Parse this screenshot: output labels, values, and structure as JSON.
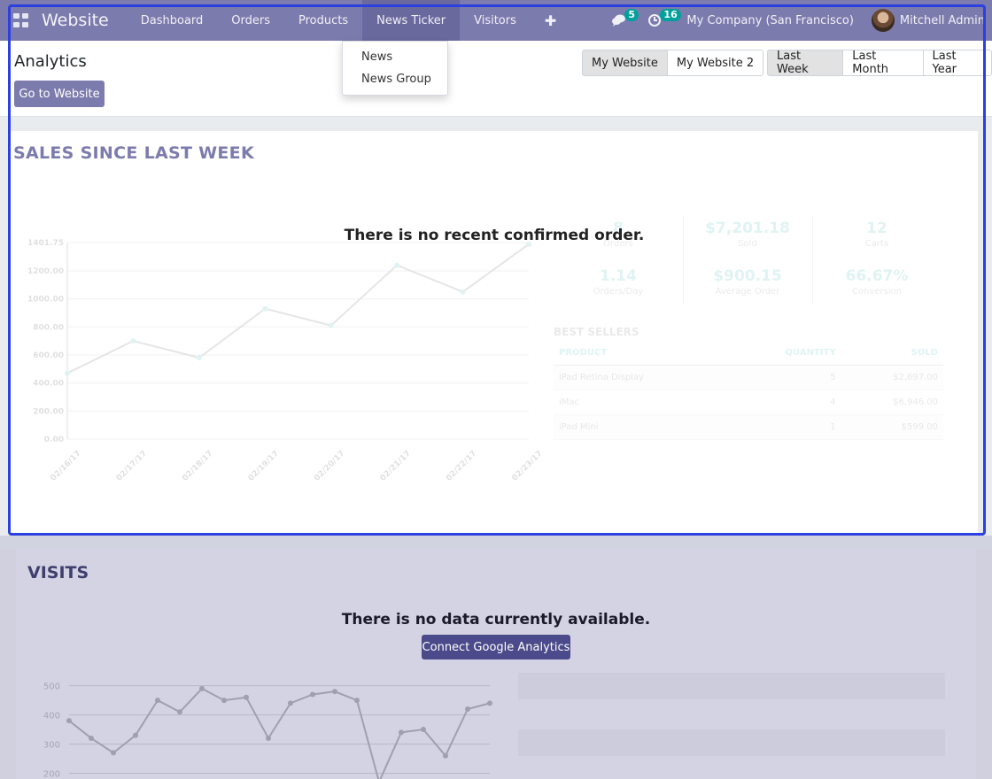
{
  "navbar": {
    "brand": "Website",
    "items": [
      {
        "label": "Dashboard"
      },
      {
        "label": "Orders"
      },
      {
        "label": "Products"
      },
      {
        "label": "News Ticker"
      },
      {
        "label": "Visitors"
      }
    ],
    "messages_count": "5",
    "activities_count": "16",
    "company": "My Company (San Francisco)",
    "user": "Mitchell Admin"
  },
  "dropdown": {
    "items": [
      {
        "label": "News"
      },
      {
        "label": "News Group"
      }
    ]
  },
  "control_panel": {
    "title": "Analytics",
    "go_to_website": "Go to Website",
    "websites": [
      {
        "label": "My Website"
      },
      {
        "label": "My Website 2"
      }
    ],
    "periods": [
      {
        "label": "Last Week"
      },
      {
        "label": "Last Month"
      },
      {
        "label": "Last Year"
      }
    ]
  },
  "sales": {
    "title": "SALES SINCE LAST WEEK",
    "empty_message": "There is no recent confirmed order.",
    "kpis": [
      {
        "value": "8",
        "label": "Orders"
      },
      {
        "value": "$7,201.18",
        "label": "Sold"
      },
      {
        "value": "12",
        "label": "Carts"
      },
      {
        "value": "1.14",
        "label": "Orders/Day"
      },
      {
        "value": "$900.15",
        "label": "Average Order"
      },
      {
        "value": "66.67%",
        "label": "Conversion"
      }
    ],
    "best_sellers": {
      "title": "BEST SELLERS",
      "headers": [
        "PRODUCT",
        "QUANTITY",
        "SOLD"
      ],
      "rows": [
        [
          "iPad Retina Display",
          "5",
          "$2,697.00"
        ],
        [
          "iMac",
          "4",
          "$6,946.00"
        ],
        [
          "iPad Mini",
          "1",
          "$599.00"
        ]
      ]
    }
  },
  "visits": {
    "title": "VISITS",
    "empty_message": "There is no data currently available.",
    "connect_button": "Connect Google Analytics"
  },
  "colors": {
    "navbar": "#7c7bad",
    "primary": "#7c7bad",
    "accent": "#00a09d",
    "highlight": "#2c3fe0"
  },
  "chart_data": {
    "type": "line",
    "x": [
      "02/16/17",
      "02/17/17",
      "02/18/17",
      "02/19/17",
      "02/20/17",
      "02/21/17",
      "02/22/17",
      "02/23/17"
    ],
    "values": [
      470,
      700,
      580,
      930,
      810,
      1240,
      1050,
      1390
    ],
    "yticks": [
      "0.00",
      "200.00",
      "400.00",
      "600.00",
      "800.00",
      "1000.00",
      "1200.00",
      "1401.75"
    ],
    "ylim": [
      0,
      1401.75
    ],
    "grid": true
  },
  "visits_chart_data": {
    "type": "line",
    "yticks": [
      "500",
      "400",
      "300",
      "200"
    ],
    "values": [
      380,
      320,
      270,
      330,
      450,
      410,
      490,
      450,
      460,
      320,
      440,
      470,
      480,
      450,
      170,
      340,
      350,
      260,
      420,
      440
    ],
    "ylim": [
      150,
      520
    ]
  }
}
